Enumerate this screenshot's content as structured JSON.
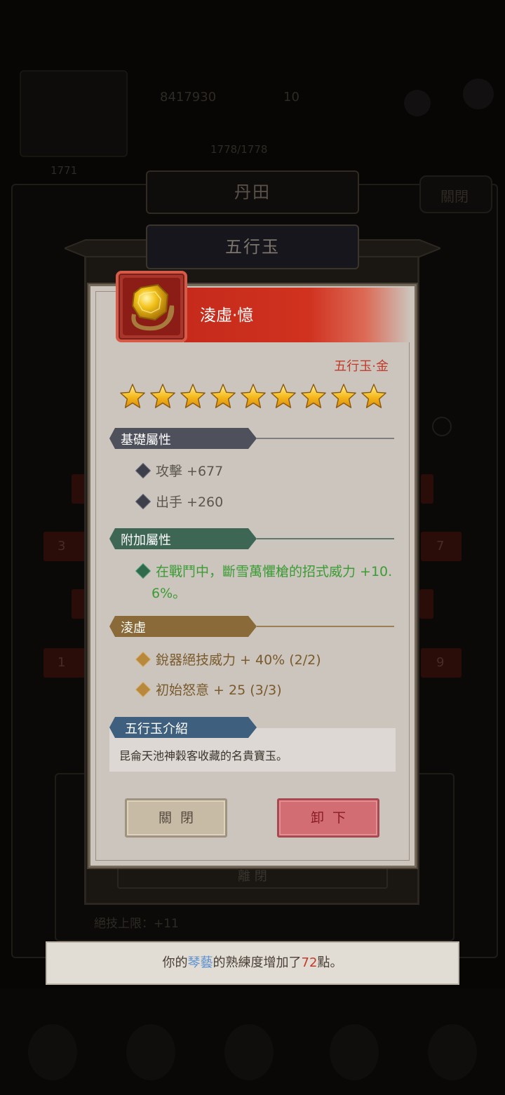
{
  "background": {
    "currency_1": "8417930",
    "currency_2": "10",
    "progress_text": "1778/1778",
    "level_text": "1771",
    "tab_top": "丹田",
    "close_top": "關閉",
    "tab_panel": "五行玉",
    "panel_close": "離 閉",
    "limit_text": "絕技上限：+11",
    "row_numbers": [
      "3",
      "7",
      "1",
      "9"
    ]
  },
  "dialog": {
    "item_name": "淩虛·憶",
    "item_type": "五行玉·金",
    "star_count": 9,
    "base_section": {
      "title": "基礎屬性",
      "attrs": [
        "攻擊 +677",
        "出手 +260"
      ]
    },
    "extra_section": {
      "title": "附加屬性",
      "line1": "在戰鬥中，斷雪萬懼槍的招式威力 +10.",
      "line2": "6%。"
    },
    "set_section": {
      "title": "淩虛",
      "attrs": [
        "銳器絕技威力 + 40% (2/2)",
        "初始怒意 + 25 (3/3)"
      ]
    },
    "intro_section": {
      "title": "五行玉介紹",
      "text": "昆侖天池神穀客收藏的名貴寶玉。"
    },
    "close_button": "關閉",
    "unequip_button": "卸下"
  },
  "toast": {
    "prefix": "你的",
    "skill": "琴藝",
    "middle": "的熟練度增加了",
    "amount": "72",
    "suffix": "點。"
  },
  "colors": {
    "banner_red": "#c52a1b",
    "dialog_bg": "#cbc5bd",
    "base_tag": "#4e505c",
    "extra_tag": "#3d6655",
    "extra_text": "#3b9b34",
    "set_tag": "#8a6a38",
    "set_text": "#7a5a2c",
    "intro_tag": "#3f5f7e",
    "toast_highlight_blue": "#5a8fd0",
    "toast_highlight_red": "#c23a2a"
  }
}
